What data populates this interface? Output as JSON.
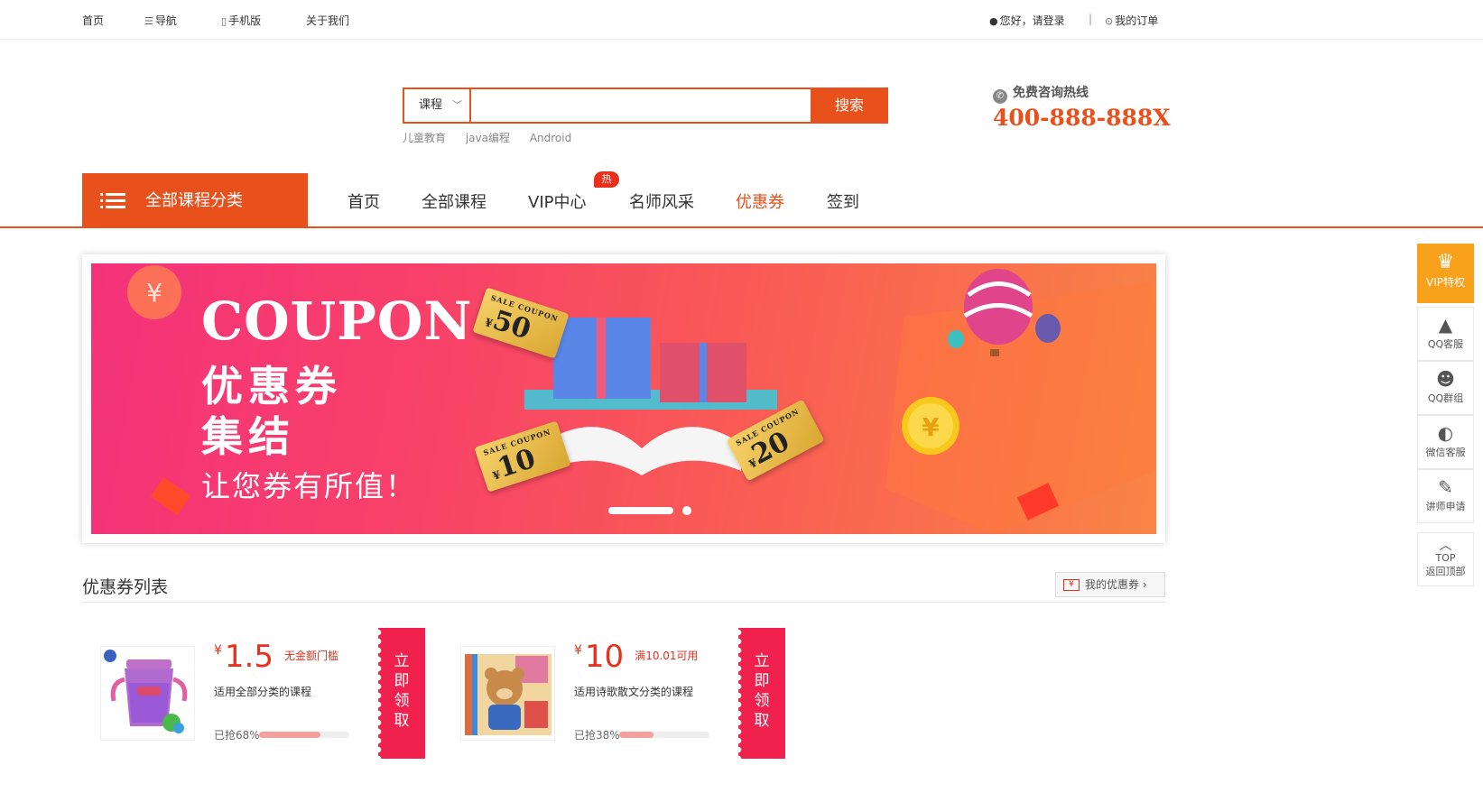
{
  "topbar": {
    "home": "首页",
    "nav": "导航",
    "mobile": "手机版",
    "about": "关于我们",
    "login": "您好，请登录",
    "sep": "|",
    "orders": "我的订单"
  },
  "search": {
    "category": "课程",
    "button": "搜索",
    "placeholder": "",
    "hotwords": [
      "儿童教育",
      "java编程",
      "Android"
    ]
  },
  "hotline": {
    "label": "免费咨询热线",
    "number": "400-888-888X"
  },
  "nav": {
    "all_categories": "全部课程分类",
    "links": [
      "首页",
      "全部课程",
      "VIP中心",
      "名师风采",
      "优惠券",
      "签到"
    ],
    "active_index": 4,
    "hot_badge": "热"
  },
  "banner": {
    "title": "COUPON",
    "line1": "优惠券",
    "line2": "集结",
    "slogan": "让您券有所值！",
    "tickets": [
      {
        "tag": "SALE COUPON",
        "currency": "¥",
        "value": "50"
      },
      {
        "tag": "SALE COUPON",
        "currency": "¥",
        "value": "10"
      },
      {
        "tag": "SALE COUPON",
        "currency": "¥",
        "value": "20"
      }
    ],
    "slides": 2,
    "active_slide": 0
  },
  "coupons": {
    "heading": "优惠券列表",
    "my_coupons": "我的优惠券",
    "items": [
      {
        "currency": "¥",
        "amount": "1.5",
        "condition": "无金额门槛",
        "scope": "适用全部分类的课程",
        "grabbed": "已抢68%",
        "progress": 0.68,
        "claim": [
          "立",
          "即",
          "领",
          "取"
        ]
      },
      {
        "currency": "¥",
        "amount": "10",
        "condition": "满10.01可用",
        "scope": "适用诗歌散文分类的课程",
        "grabbed": "已抢38%",
        "progress": 0.38,
        "claim": [
          "立",
          "即",
          "领",
          "取"
        ]
      }
    ]
  },
  "side": {
    "vip": "VIP特权",
    "qq_service": "QQ客服",
    "qq_group": "QQ群组",
    "wechat": "微信客服",
    "teacher": "讲师申请",
    "top_label": "TOP",
    "back_top": "返回顶部"
  },
  "colors": {
    "accent": "#e8501c",
    "claim": "#f0214c",
    "vip": "#f9a11b"
  }
}
